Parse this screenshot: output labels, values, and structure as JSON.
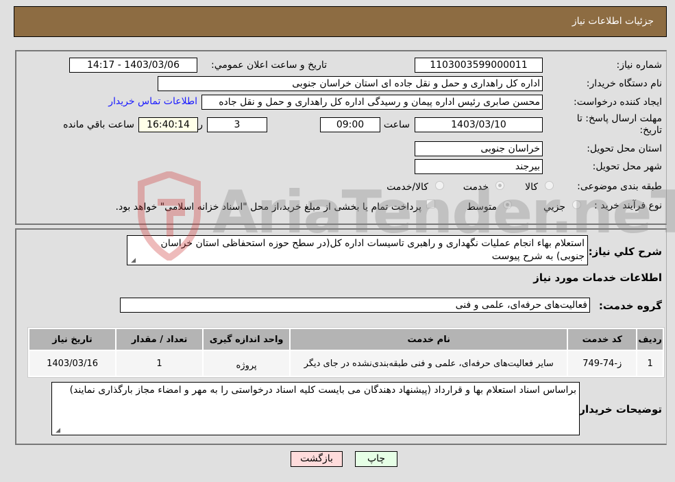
{
  "header": {
    "title": "جزئیات اطلاعات نیاز"
  },
  "fields": {
    "need_number_label": "شماره نیاز:",
    "need_number": "1103003599000011",
    "announce_label": "تاریخ و ساعت اعلان عمومي:",
    "announce_value": "1403/03/06 - 14:17",
    "buyer_org_label": "نام دستگاه خريدار:",
    "buyer_org": "اداره کل راهداری و حمل و نقل جاده ای استان خراسان جنوبی",
    "creator_label": "ایجاد کننده درخواست:",
    "creator": "محسن صابری رئیس اداره پیمان و رسیدگی اداره کل راهداری و حمل و نقل جاده",
    "buyer_contact_link": "اطلاعات تماس خريدار",
    "deadline_label": "مهلت ارسال پاسخ: تا تاریخ:",
    "deadline_date": "1403/03/10",
    "time_label": "ساعت",
    "deadline_time": "09:00",
    "days": "3",
    "days_label": "روز و",
    "remaining_time": "16:40:14",
    "remaining_label": "ساعت باقي مانده",
    "province_label": "استان محل تحویل:",
    "province": "خراسان جنوبی",
    "city_label": "شهر محل تحویل:",
    "city": "بیرجند",
    "category_label": "طبقه بندی موضوعی:",
    "category_options": [
      {
        "label": "کالا",
        "checked": false
      },
      {
        "label": "خدمت",
        "checked": true
      },
      {
        "label": "کالا/خدمت",
        "checked": false
      }
    ],
    "process_label": "نوع فرآیند خرید :",
    "process_options": [
      {
        "label": "جزيي",
        "checked": false
      },
      {
        "label": "متوسط",
        "checked": true
      }
    ],
    "treasury_checkbox_label": "پرداخت تمام یا بخشی از مبلغ خرید،از محل \"اسناد خزانه اسلامی\" خواهد بود.",
    "treasury_checked": false
  },
  "details": {
    "summary_label": "شرح کلي نياز:",
    "summary": "استعلام بهاء انجام عملیات نگهداری و راهبری تاسیسات اداره کل(در سطح حوزه استحفاظی استان خراسان جنوبی) به شرح پیوست",
    "services_heading": "اطلاعات خدمات مورد نياز",
    "service_group_label": "گروه خدمت:",
    "service_group": "فعالیت‌های حرفه‌ای، علمی و فنی",
    "table": {
      "headers": [
        "رديف",
        "کد خدمت",
        "نام خدمت",
        "واحد اندازه گیری",
        "تعداد / مقدار",
        "تاریخ نیاز"
      ],
      "rows": [
        [
          "1",
          "ز-74-749",
          "سایر فعالیت‌های حرفه‌ای، علمی و فنی طبقه‌بندی‌نشده در جای دیگر",
          "پروژه",
          "1",
          "1403/03/16"
        ]
      ]
    },
    "buyer_notes_label": "توضیحات خریدار:",
    "buyer_notes": "براساس اسناد استعلام بها و قرارداد (پیشنهاد دهندگان می بایست کلیه اسناد درخواستی را به مهر و امضاء مجاز بارگذاری نمایند)"
  },
  "buttons": {
    "print": "چاپ",
    "back": "بازگشت"
  },
  "watermark": {
    "text": "AriaTender.neT"
  },
  "colors": {
    "header_bg": "#8d6c42",
    "print_bg": "#e6ffe6",
    "back_bg": "#ffdcdc",
    "link": "#1a1aff"
  }
}
